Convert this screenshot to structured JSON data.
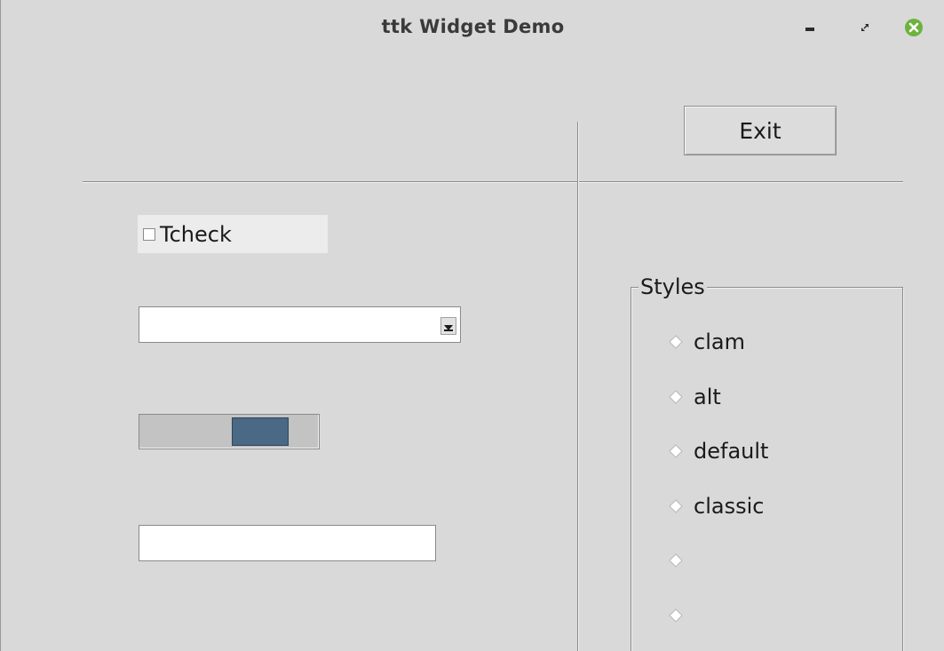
{
  "window": {
    "title": "ttk Widget Demo"
  },
  "toolbar": {
    "exit_label": "Exit"
  },
  "checkbutton": {
    "label": "Tcheck",
    "checked": false
  },
  "combobox": {
    "value": ""
  },
  "scale": {
    "value_fraction": 0.68
  },
  "entry": {
    "value": ""
  },
  "styles": {
    "legend": "Styles",
    "options": [
      {
        "label": "clam"
      },
      {
        "label": "alt"
      },
      {
        "label": "default"
      },
      {
        "label": "classic"
      },
      {
        "label": ""
      },
      {
        "label": ""
      }
    ]
  },
  "colors": {
    "background": "#d9d9d9",
    "slider_thumb": "#4a6984",
    "close_button": "#6cb33f"
  }
}
